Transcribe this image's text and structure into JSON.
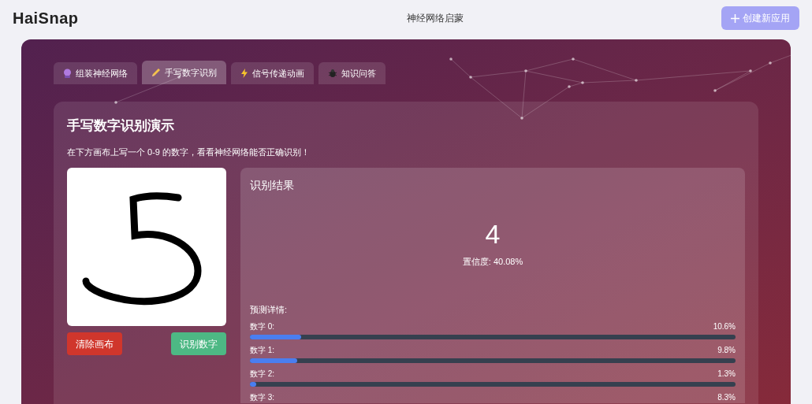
{
  "header": {
    "logo": "HaiSnap",
    "title": "神经网络启蒙",
    "create_button": "创建新应用"
  },
  "tabs": [
    {
      "label": "组装神经网络",
      "kind": "crystal",
      "selected": false
    },
    {
      "label": "手写数字识别",
      "kind": "pencil",
      "selected": true
    },
    {
      "label": "信号传递动画",
      "kind": "bolt",
      "selected": false
    },
    {
      "label": "知识问答",
      "kind": "bug",
      "selected": false
    }
  ],
  "panel": {
    "title": "手写数字识别演示",
    "subtitle": "在下方画布上写一个 0-9 的数字，看看神经网络能否正确识别！",
    "clear_button": "清除画布",
    "recognize_button": "识别数字"
  },
  "result": {
    "title": "识别结果",
    "digit": "4",
    "confidence": "置信度: 40.08%",
    "details_title": "预测详情:",
    "predictions": [
      {
        "label": "数字 0:",
        "value": "10.6%",
        "level": 0.106
      },
      {
        "label": "数字 1:",
        "value": "9.8%",
        "level": 0.098
      },
      {
        "label": "数字 2:",
        "value": "1.3%",
        "level": 0.013
      },
      {
        "label": "数字 3:",
        "value": "8.3%"
      }
    ]
  }
}
